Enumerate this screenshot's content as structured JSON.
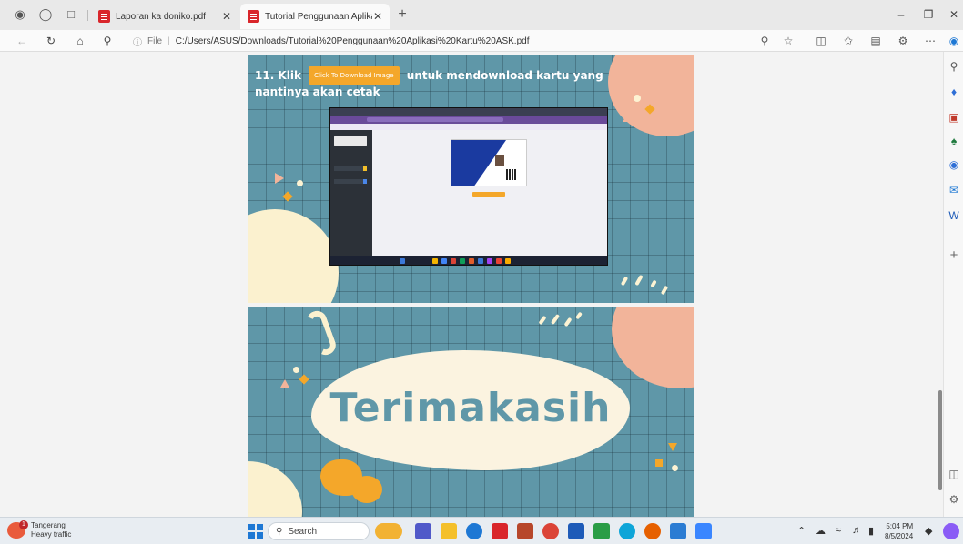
{
  "tabs": [
    {
      "title": "Laporan ka doniko.pdf",
      "active": false
    },
    {
      "title": "Tutorial Penggunaan Aplikasi Ka",
      "active": true
    }
  ],
  "address_bar": {
    "scheme": "File",
    "url": "C:/Users/ASUS/Downloads/Tutorial%20Penggunaan%20Aplikasi%20Kartu%20ASK.pdf"
  },
  "pdf": {
    "step_number": "11. Klik",
    "inline_button": "Click To Download Image",
    "step_text": "untuk mendownload kartu yang nantinya akan cetak",
    "thanks": "Terimakasih"
  },
  "taskbar": {
    "weather_place": "Tangerang",
    "weather_status": "Heavy traffic",
    "search_placeholder": "Search",
    "time": "5:04 PM",
    "date": "8/5/2024"
  },
  "colors": {
    "page_teal": "#5f97a8",
    "peach": "#f2b49a",
    "cream": "#fbf1cf",
    "orange": "#f4a72a",
    "pdf_red": "#d9262b"
  }
}
